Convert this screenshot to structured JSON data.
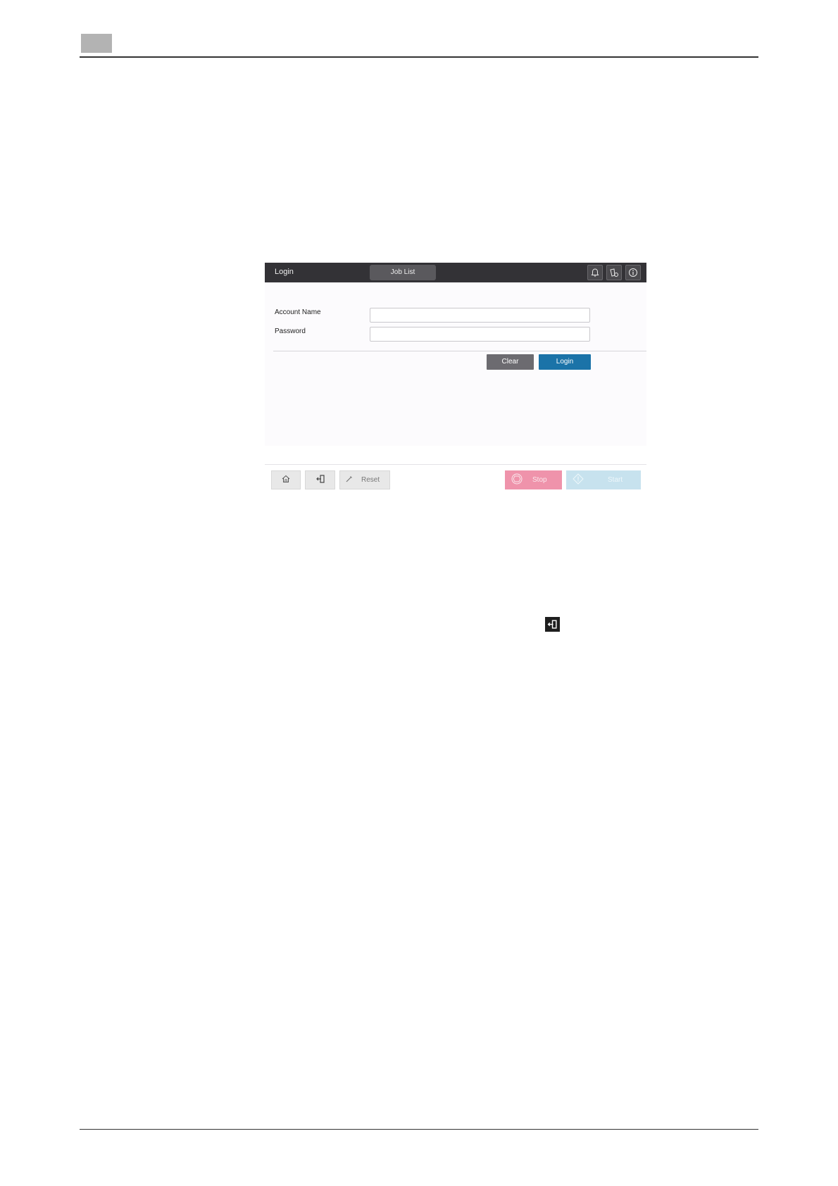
{
  "panel": {
    "title": "Login",
    "tab_job_list": "Job List",
    "icons": {
      "notification": "bell-icon",
      "status": "device-status-icon",
      "info": "info-icon"
    },
    "form": {
      "account_name_label": "Account Name",
      "account_name_value": "",
      "password_label": "Password",
      "password_value": "",
      "clear_label": "Clear",
      "login_label": "Login"
    },
    "bottom_bar": {
      "home_icon": "home-icon",
      "logout_icon": "logout-icon",
      "reset_label": "Reset",
      "stop_label": "Stop",
      "start_label": "Start"
    },
    "colors": {
      "topbar": "#333236",
      "login_button": "#1b73a8",
      "clear_button": "#6c6b70",
      "stop_button": "#ef93ab",
      "start_button": "#c7e2ee"
    }
  },
  "inline_icon": "logout-icon"
}
